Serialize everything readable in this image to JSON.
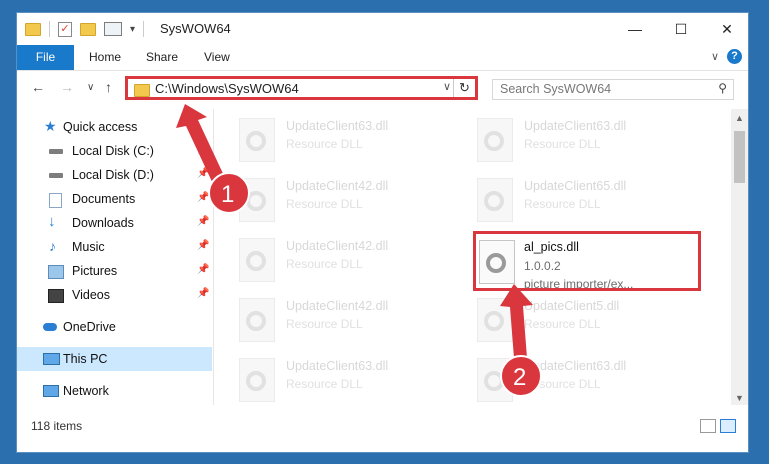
{
  "window": {
    "title": "SysWOW64",
    "controls": {
      "minimize": "—",
      "maximize": "☐",
      "close": "✕"
    }
  },
  "ribbon": {
    "tabs": [
      "File",
      "Home",
      "Share",
      "View"
    ]
  },
  "navigation": {
    "back": "←",
    "forward": "→",
    "recent": "∨",
    "up": "↑",
    "address": "C:\\Windows\\SysWOW64",
    "refresh": "↻",
    "search_placeholder": "Search SysWOW64"
  },
  "sidebar": {
    "items": [
      {
        "label": "Quick access",
        "icon": "star-icon",
        "pinned": false
      },
      {
        "label": "Local Disk (C:)",
        "icon": "drive-icon",
        "pinned": true
      },
      {
        "label": "Local Disk (D:)",
        "icon": "drive-icon",
        "pinned": true
      },
      {
        "label": "Documents",
        "icon": "documents-icon",
        "pinned": true
      },
      {
        "label": "Downloads",
        "icon": "downloads-icon",
        "pinned": true
      },
      {
        "label": "Music",
        "icon": "music-icon",
        "pinned": true
      },
      {
        "label": "Pictures",
        "icon": "pictures-icon",
        "pinned": true
      },
      {
        "label": "Videos",
        "icon": "videos-icon",
        "pinned": true
      },
      {
        "label": "OneDrive",
        "icon": "cloud-icon",
        "pinned": false
      },
      {
        "label": "This PC",
        "icon": "computer-icon",
        "pinned": false,
        "selected": true
      },
      {
        "label": "Network",
        "icon": "network-icon",
        "pinned": false
      }
    ]
  },
  "files": [
    {
      "name": "UpdateClient63.dll",
      "description": "Resource DLL",
      "column": 0,
      "row": 0
    },
    {
      "name": "UpdateClient63.dll",
      "description": "Resource DLL",
      "column": 1,
      "row": 0
    },
    {
      "name": "UpdateClient42.dll",
      "description": "Resource DLL",
      "column": 0,
      "row": 1
    },
    {
      "name": "UpdateClient65.dll",
      "description": "Resource DLL",
      "column": 1,
      "row": 1
    },
    {
      "name": "UpdateClient42.dll",
      "description": "Resource DLL",
      "column": 0,
      "row": 2
    },
    {
      "name": "al_pics.dll",
      "version": "1.0.0.2",
      "description": "picture importer/ex...",
      "column": 1,
      "row": 2,
      "highlighted": true
    },
    {
      "name": "UpdateClient42.dll",
      "description": "Resource DLL",
      "column": 0,
      "row": 3
    },
    {
      "name": "UpdateClient5.dll",
      "description": "Resource DLL",
      "column": 1,
      "row": 3
    },
    {
      "name": "UpdateClient63.dll",
      "description": "Resource DLL",
      "column": 0,
      "row": 4
    },
    {
      "name": "UpdateClient63.dll",
      "description": "Resource DLL",
      "column": 1,
      "row": 4
    }
  ],
  "status": {
    "item_count": "118 items"
  },
  "annotations": {
    "badges": [
      "1",
      "2"
    ],
    "color": "#d9363e"
  }
}
